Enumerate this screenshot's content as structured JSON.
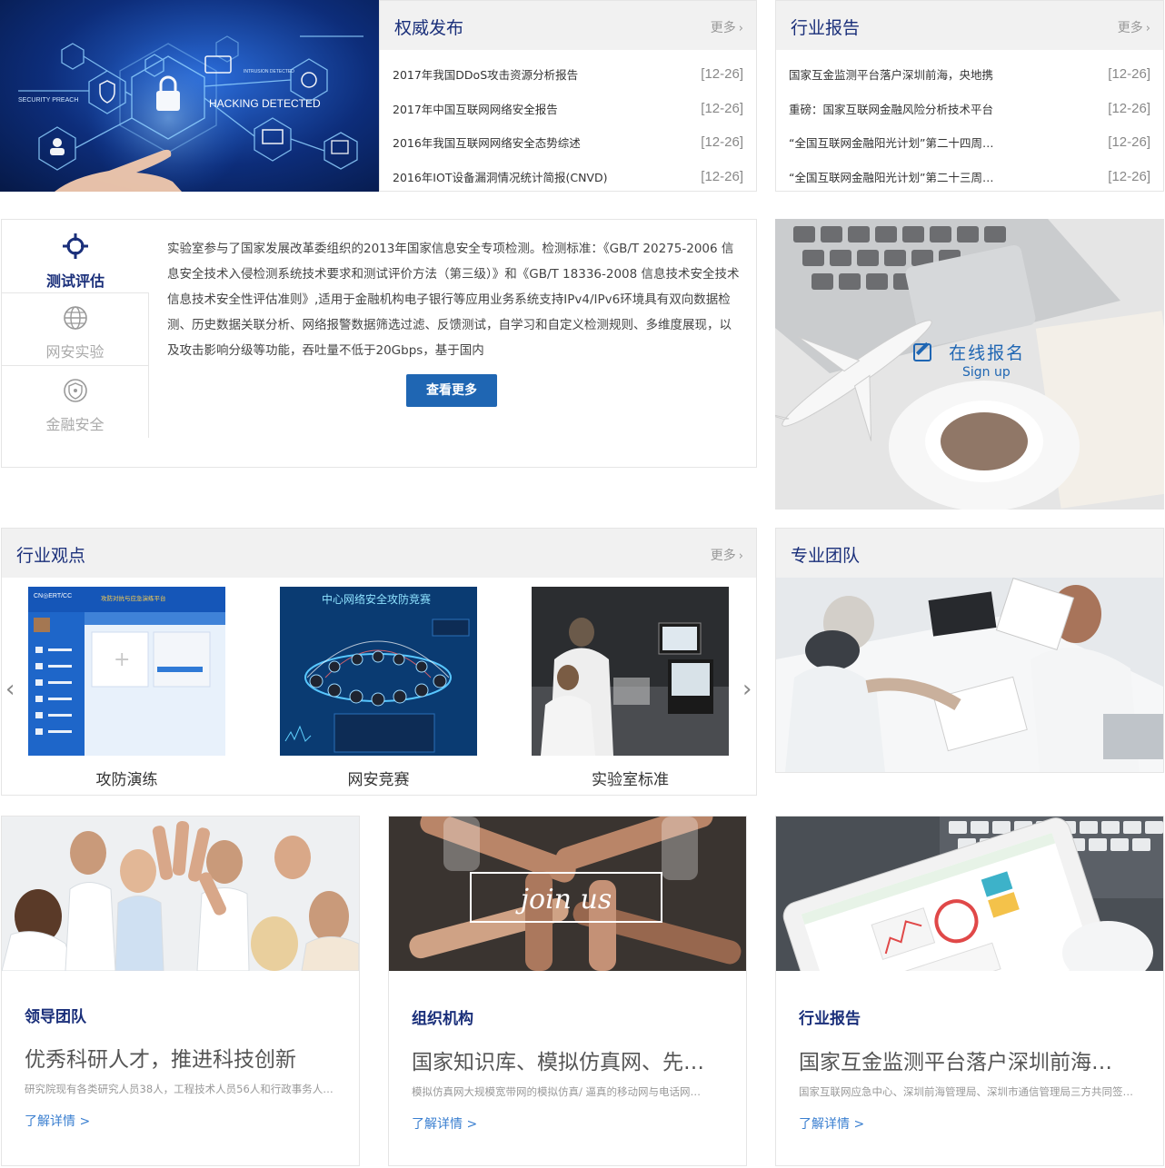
{
  "authority": {
    "title": "权威发布",
    "more": "更多",
    "items": [
      {
        "text": "2017年我国DDoS攻击资源分析报告",
        "date": "[12-26]"
      },
      {
        "text": "2017年中国互联网网络安全报告",
        "date": "[12-26]"
      },
      {
        "text": "2016年我国互联网网络安全态势综述",
        "date": "[12-26]"
      },
      {
        "text": "2016年IOT设备漏洞情况统计简报(CNVD)",
        "date": "[12-26]"
      }
    ]
  },
  "hero": {
    "labels": [
      "SECURITY PREACH",
      "HACKING DETECTED",
      "INTRUSION DETECTED"
    ]
  },
  "industry_report": {
    "title": "行业报告",
    "more": "更多",
    "items": [
      {
        "text": "国家互金监测平台落户深圳前海，央地携",
        "date": "[12-26]"
      },
      {
        "text": "重磅：国家互联网金融风险分析技术平台",
        "date": "[12-26]"
      },
      {
        "text": "“全国互联网金融阳光计划”第二十四周…",
        "date": "[12-26]"
      },
      {
        "text": "“全国互联网金融阳光计划”第二十三周…",
        "date": "[12-26]"
      }
    ]
  },
  "tabs": {
    "items": [
      {
        "label": "测试评估",
        "icon": "crosshair-icon",
        "active": true
      },
      {
        "label": "网安实验",
        "icon": "globe-icon",
        "active": false
      },
      {
        "label": "金融安全",
        "icon": "shield-icon",
        "active": false
      }
    ],
    "content": "实验室参与了国家发展改革委组织的2013年国家信息安全专项检测。检测标准：《GB/T 20275-2006 信息安全技术入侵检测系统技术要求和测试评价方法（第三级）》和《GB/T 18336-2008 信息技术安全技术信息技术安全性评估准则》,适用于金融机构电子银行等应用业务系统支持IPv4/IPv6环境具有双向数据检测、历史数据关联分析、网络报警数据筛选过滤、反馈测试，自学习和自定义检测规则、多维度展现，以及攻击影响分级等功能，吞吐量不低于20Gbps，基于国内",
    "button": "查看更多"
  },
  "signup": {
    "title": "在线报名",
    "subtitle": "Sign up"
  },
  "views": {
    "title": "行业观点",
    "more": "更多",
    "cards": [
      {
        "caption": "攻防演练",
        "screen_brand": "CN◎ERT/CC",
        "screen_title": "攻防对抗与应急演练平台"
      },
      {
        "caption": "网安竞赛",
        "screen_title": "中心网络安全攻防竞赛"
      },
      {
        "caption": "实验室标准"
      }
    ],
    "prev": "‹",
    "next": "›"
  },
  "team": {
    "title": "专业团队"
  },
  "bottom_cards": [
    {
      "category": "领导团队",
      "headline": "优秀科研人才，推进科技创新",
      "desc": "研究院现有各类研究人员38人，工程技术人员56人和行政事务人…",
      "link": "了解详情 >"
    },
    {
      "category": "组织机构",
      "headline": "国家知识库、模拟仿真网、先…",
      "desc": "模拟仿真网大规模宽带网的模拟仿真/ 逼真的移动网与电话网…",
      "link": "了解详情 >",
      "image_text": "join us"
    },
    {
      "category": "行业报告",
      "headline": "国家互金监测平台落户深圳前海…",
      "desc": "国家互联网应急中心、深圳前海管理局、深圳市通信管理局三方共同签…",
      "link": "了解详情 >"
    }
  ],
  "colors": {
    "title_navy": "#1a2f7a",
    "button_blue": "#1f66b3",
    "link_blue": "#3a7fd0",
    "header_gray": "#f1f1f1"
  }
}
